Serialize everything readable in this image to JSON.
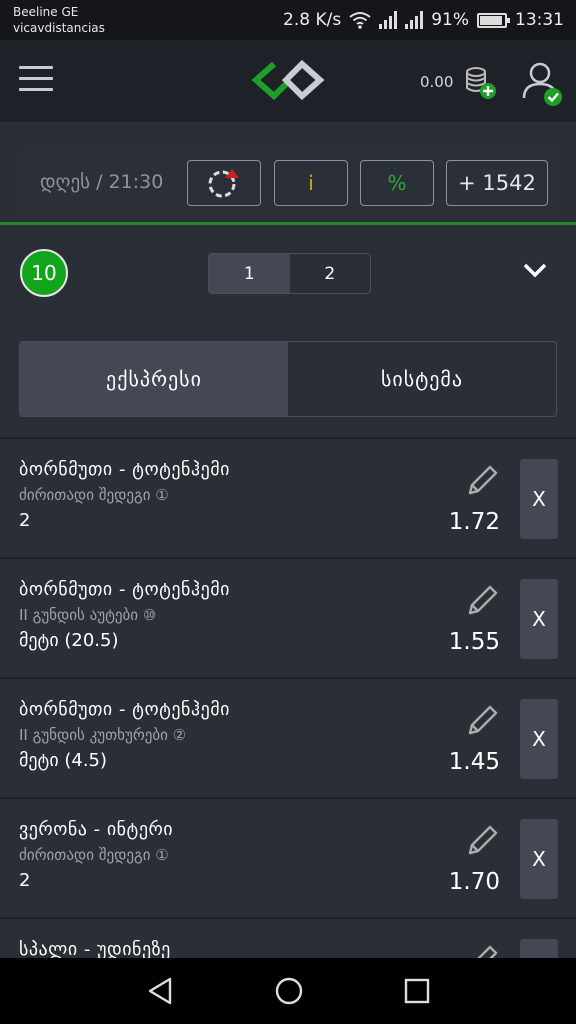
{
  "status_bar": {
    "carrier": "Beeline GE",
    "network_name": "vicavdistancias",
    "speed": "2.8 K/s",
    "battery": "91%",
    "battery_level": 0.91,
    "time": "13:31"
  },
  "header": {
    "balance": "0.00",
    "icons": [
      "menu-icon",
      "logo",
      "coins-add-icon",
      "user-verified-icon"
    ]
  },
  "info_bar": {
    "time": "დღეს / 21:30",
    "info_label": "i",
    "percent_label": "%",
    "more_markets": "+ 1542"
  },
  "betslip": {
    "count": "10",
    "pages": [
      "1",
      "2"
    ],
    "active_page": 0,
    "tabs": [
      "ექსპრესი",
      "სისტემა"
    ],
    "active_tab": 0,
    "remove_label": "X",
    "bets": [
      {
        "match": "ბორნმუთი - ტოტენჰემი",
        "market": "ძირითადი შედეგი ①",
        "pick": "2",
        "odds": "1.72"
      },
      {
        "match": "ბორნმუთი - ტოტენჰემი",
        "market": "II გუნდის აუტები ⑩",
        "pick": "მეტი (20.5)",
        "odds": "1.55"
      },
      {
        "match": "ბორნმუთი - ტოტენჰემი",
        "market": "II გუნდის კუთხურები ②",
        "pick": "მეტი (4.5)",
        "odds": "1.45"
      },
      {
        "match": "ვერონა - ინტერი",
        "market": "ძირითადი შედეგი ①",
        "pick": "2",
        "odds": "1.70"
      },
      {
        "match": "სპალი - უდინეზე",
        "market": "",
        "pick": "",
        "odds": ""
      }
    ]
  },
  "colors": {
    "accent_green": "#12a51c",
    "warning_yellow": "#e0a017",
    "background": "#2a2e36",
    "header": "#1e2127"
  }
}
